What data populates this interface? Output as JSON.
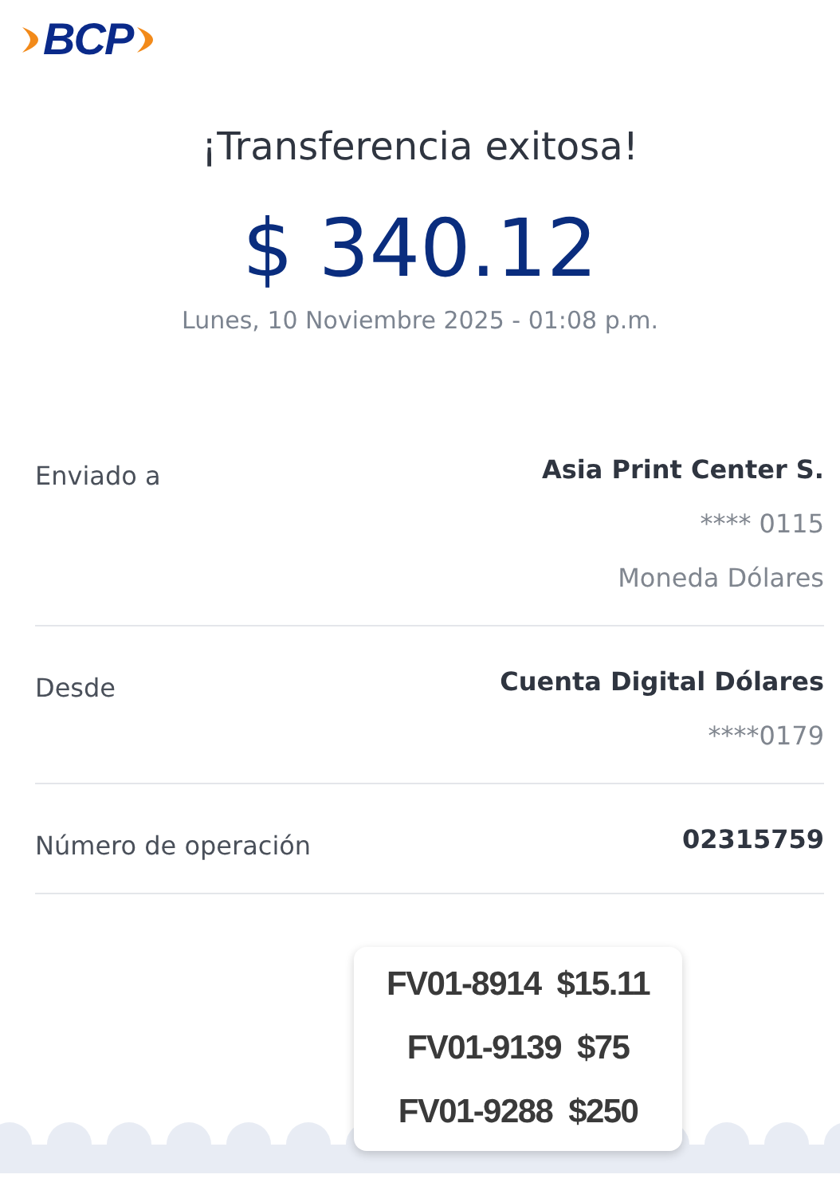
{
  "logo": {
    "text": "BCP"
  },
  "header": {
    "title": "¡Transferencia exitosa!",
    "amount": "$ 340.12",
    "date": "Lunes, 10 Noviembre 2025 - 01:08 p.m."
  },
  "details": [
    {
      "label": "Enviado a",
      "values": [
        {
          "text": "Asia Print Center S.",
          "emphasis": true
        },
        {
          "text": "**** 0115",
          "emphasis": false
        },
        {
          "text": "Moneda Dólares",
          "emphasis": false
        }
      ]
    },
    {
      "label": "Desde",
      "values": [
        {
          "text": "Cuenta Digital Dólares",
          "emphasis": true
        },
        {
          "text": "****0179",
          "emphasis": false
        }
      ]
    },
    {
      "label": "Número de operación",
      "values": [
        {
          "text": "02315759",
          "emphasis": true
        }
      ]
    }
  ],
  "note": {
    "lines": [
      {
        "invoice": "FV01-8914",
        "amount": "$15.11"
      },
      {
        "invoice": "FV01-9139",
        "amount": "$75"
      },
      {
        "invoice": "FV01-9288",
        "amount": "$250"
      }
    ]
  }
}
